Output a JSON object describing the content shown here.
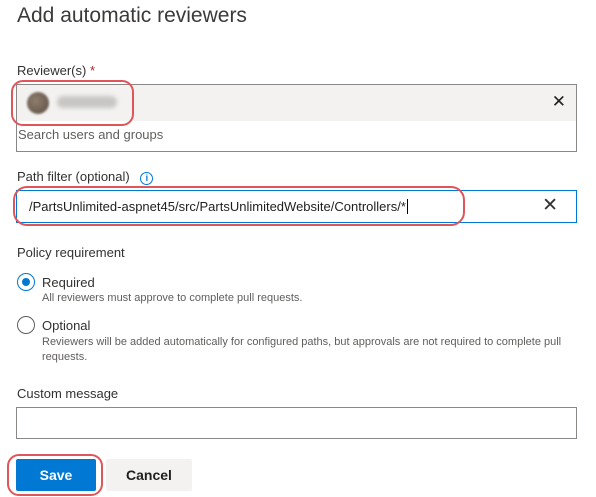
{
  "dialog": {
    "title": "Add automatic reviewers"
  },
  "reviewers": {
    "label": "Reviewer(s)",
    "required_marker": "*",
    "placeholder": "Search users and groups",
    "remove_icon": "close-icon"
  },
  "path_filter": {
    "label": "Path filter (optional)",
    "value": "/PartsUnlimited-aspnet45/src/PartsUnlimitedWebsite/Controllers/*",
    "clear_icon": "close-icon",
    "info_icon": "info-icon"
  },
  "policy": {
    "label": "Policy requirement",
    "options": [
      {
        "label": "Required",
        "description": "All reviewers must approve to complete pull requests.",
        "selected": true
      },
      {
        "label": "Optional",
        "description": "Reviewers will be added automatically for configured paths, but approvals are not required to complete pull requests.",
        "selected": false
      }
    ]
  },
  "custom_message": {
    "label": "Custom message",
    "value": ""
  },
  "actions": {
    "save_label": "Save",
    "cancel_label": "Cancel"
  },
  "colors": {
    "accent": "#0078d4",
    "annotation": "#e0555a"
  }
}
